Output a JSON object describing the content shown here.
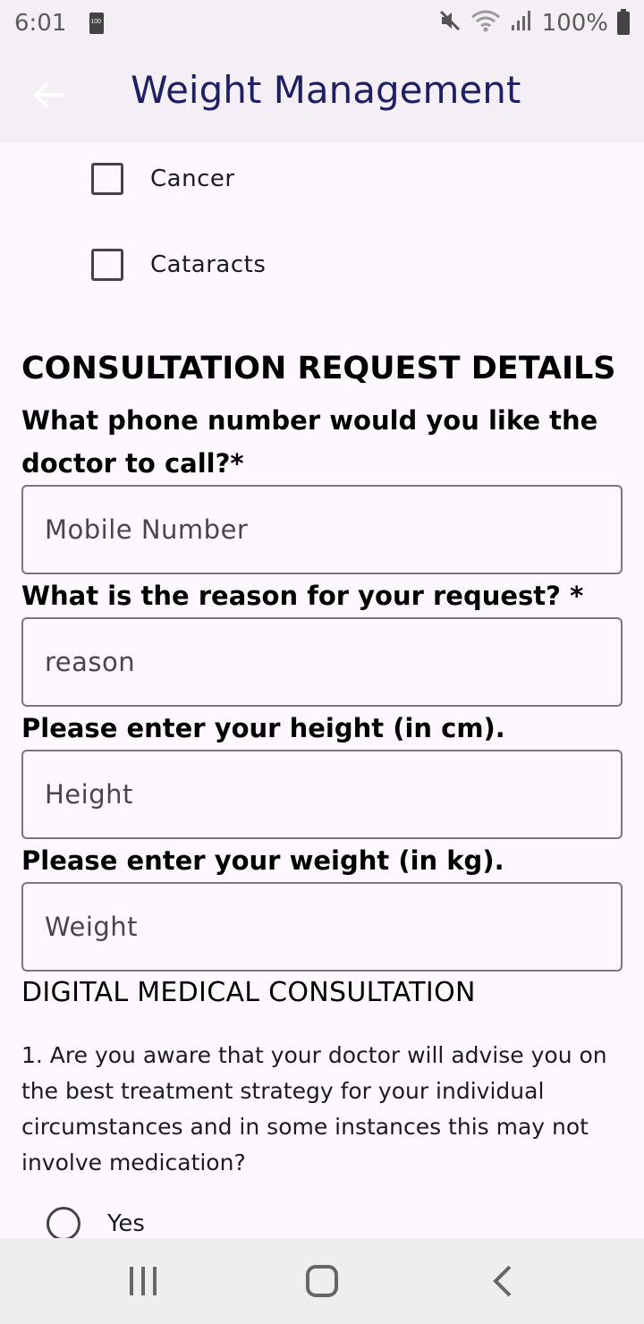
{
  "status_bar": {
    "time": "6:01",
    "battery": "100%",
    "icons": [
      "sd-card-icon",
      "mute-icon",
      "wifi-icon",
      "signal-icon",
      "battery-icon"
    ]
  },
  "app_bar": {
    "title": "Weight Management",
    "back_icon": "arrow-left-icon",
    "background": "#f3eff4",
    "title_color": "#1f1f64"
  },
  "conditions": {
    "items": [
      {
        "label": "Cancer",
        "checked": false
      },
      {
        "label": "Cataracts",
        "checked": false
      }
    ]
  },
  "consultation": {
    "heading": "CONSULTATION REQUEST DETAILS",
    "phone_question": "What phone number would you like the doctor to call?*",
    "phone_placeholder": "Mobile Number",
    "phone_value": "",
    "reason_question": "What is the reason for your request? *",
    "reason_placeholder": "reason",
    "reason_value": "",
    "height_question": "Please enter your height (in cm).",
    "height_placeholder": "Height",
    "height_value": "",
    "weight_question": "Please enter your weight (in kg).",
    "weight_placeholder": "Weight",
    "weight_value": ""
  },
  "digital": {
    "heading": "DIGITAL MEDICAL CONSULTATION",
    "question_1": "1. Are you aware that your doctor will advise you on the best treatment strategy for your individual circumstances and in some instances this may not involve medication?",
    "options": [
      {
        "label": "Yes",
        "selected": false
      }
    ]
  },
  "nav_bar": {
    "icons": [
      "recent-apps-icon",
      "home-icon",
      "back-icon"
    ]
  }
}
